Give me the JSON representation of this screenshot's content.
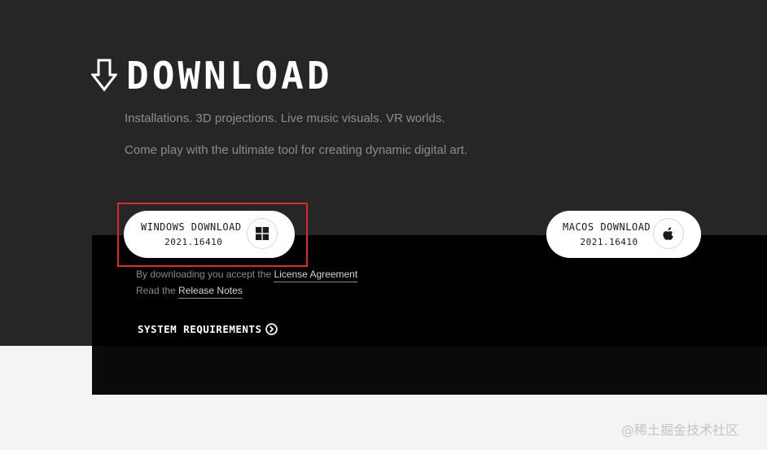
{
  "header": {
    "title": "DOWNLOAD",
    "icon": "download-arrow-icon",
    "taglines": [
      "Installations. 3D projections. Live music visuals. VR worlds.",
      "Come play with the ultimate tool for creating dynamic digital art."
    ]
  },
  "downloads": {
    "windows": {
      "label": "WINDOWS DOWNLOAD",
      "version": "2021.16410",
      "icon": "windows-logo-icon"
    },
    "macos": {
      "label": "MACOS DOWNLOAD",
      "version": "2021.16410",
      "icon": "apple-logo-icon"
    }
  },
  "legal": {
    "agreement_prefix": "By downloading you accept the ",
    "agreement_link": "License Agreement",
    "notes_prefix": "Read the ",
    "notes_link": "Release Notes"
  },
  "system_requirements": {
    "label": "SYSTEM REQUIREMENTS",
    "icon": "chevron-right-circle-icon"
  },
  "watermark": "@稀土掘金技术社区",
  "colors": {
    "page_dark": "#262626",
    "panel_black": "#000000",
    "page_light": "#f4f4f4",
    "highlight": "#e02a2a",
    "button_bg": "#ffffff"
  }
}
